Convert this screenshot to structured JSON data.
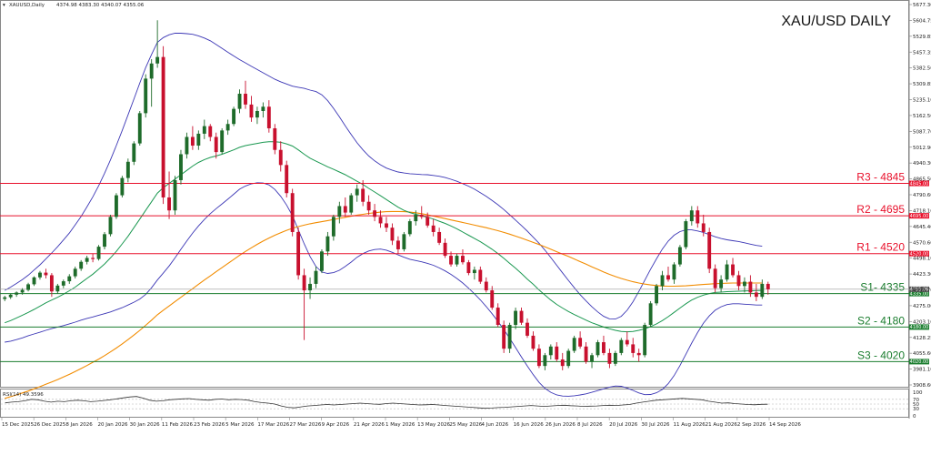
{
  "chart_data": {
    "type": "candlestick",
    "title": "XAU/USD DAILY",
    "header": {
      "symbol_label": "XAUUSD,Daily",
      "ohlc_text": "4374.98 4383.30 4340.07 4355.06"
    },
    "ylim": [
      3908,
      5677
    ],
    "y_ticks": [
      "5677.30",
      "5604.75",
      "5529.85",
      "5457.35",
      "5382.50",
      "5309.85",
      "5235.10",
      "5162.50",
      "5087.70",
      "5012.90",
      "4940.30",
      "4865.50",
      "4790.60",
      "4718.10",
      "4645.40",
      "4570.60",
      "4498.10",
      "4423.30",
      "4350.70",
      "4275.00",
      "4203.10",
      "4128.25",
      "4055.60",
      "3981.10",
      "3908.60"
    ],
    "x_labels": [
      "15 Dec 2025",
      "26 Dec 2025",
      "8 Jan 2026",
      "20 Jan 2026",
      "30 Jan 2026",
      "11 Feb 2026",
      "23 Feb 2026",
      "5 Mar 2026",
      "17 Mar 2026",
      "27 Mar 2026",
      "9 Apr 2026",
      "21 Apr 2026",
      "1 May 2026",
      "13 May 2026",
      "25 May 2026",
      "4 Jun 2026",
      "16 Jun 2026",
      "26 Jun 2026",
      "8 Jul 2026",
      "20 Jul 2026",
      "30 Jul 2026",
      "11 Aug 2026",
      "21 Aug 2026",
      "2 Sep 2026",
      "14 Sep 2026"
    ],
    "current_price": {
      "value": 4355.06,
      "label": "4355.06"
    },
    "levels": [
      {
        "name": "R3 - 4845",
        "value": 4845,
        "tag": "4845.00",
        "color": "#e8102b"
      },
      {
        "name": "R2 - 4695",
        "value": 4695,
        "tag": "4695.00",
        "color": "#e8102b"
      },
      {
        "name": "R1 - 4520",
        "value": 4520,
        "tag": "4520.00",
        "color": "#e8102b"
      },
      {
        "name": "S1- 4335",
        "value": 4335,
        "tag": "4335.00",
        "color": "#1a7d2e"
      },
      {
        "name": "S2 - 4180",
        "value": 4180,
        "tag": "4180.00",
        "color": "#1a7d2e"
      },
      {
        "name": "S3 - 4020",
        "value": 4020,
        "tag": "4020.00",
        "color": "#1a7d2e"
      }
    ],
    "colors": {
      "bull": "#1e6b2a",
      "bear": "#c8102e",
      "bollinger": "#3b36b5",
      "ma_fast": "#1a9850",
      "ma_slow": "#f28c00",
      "rsi": "#333333"
    },
    "rsi": {
      "label": "RSI(14) 49.3596",
      "ylim": [
        0,
        100
      ],
      "levels": [
        30,
        50,
        70
      ],
      "tick_labels": [
        "100",
        "70",
        "50",
        "30",
        "0"
      ],
      "values": [
        55,
        58,
        60,
        64,
        70,
        68,
        62,
        58,
        62,
        60,
        64,
        66,
        64,
        60,
        62,
        65,
        68,
        72,
        76,
        80,
        82,
        75,
        66,
        62,
        64,
        68,
        70,
        72,
        73,
        70,
        68,
        66,
        70,
        71,
        68,
        70,
        69,
        66,
        60,
        56,
        54,
        50,
        42,
        36,
        34,
        38,
        42,
        44,
        46,
        48,
        46,
        48,
        50,
        52,
        54,
        52,
        50,
        49,
        52,
        54,
        52,
        50,
        48,
        46,
        47,
        48,
        46,
        44,
        42,
        40,
        38,
        36,
        34,
        32,
        33,
        35,
        36,
        38,
        40,
        42,
        44,
        42,
        40,
        42,
        44,
        45,
        43,
        42,
        40,
        41,
        42,
        44,
        45,
        44,
        46,
        48,
        54,
        58,
        62,
        66,
        68,
        70,
        72,
        74,
        72,
        70,
        68,
        62,
        58,
        54,
        55,
        52,
        50,
        48,
        47,
        49,
        49.4
      ]
    },
    "candles": [
      [
        4310,
        4325,
        4300,
        4318
      ],
      [
        4318,
        4335,
        4310,
        4330
      ],
      [
        4330,
        4345,
        4320,
        4340
      ],
      [
        4340,
        4360,
        4330,
        4352
      ],
      [
        4352,
        4385,
        4345,
        4378
      ],
      [
        4378,
        4415,
        4370,
        4410
      ],
      [
        4410,
        4440,
        4400,
        4432
      ],
      [
        4432,
        4450,
        4405,
        4420
      ],
      [
        4420,
        4430,
        4320,
        4345
      ],
      [
        4345,
        4380,
        4335,
        4372
      ],
      [
        4372,
        4400,
        4360,
        4392
      ],
      [
        4392,
        4425,
        4380,
        4415
      ],
      [
        4415,
        4460,
        4405,
        4450
      ],
      [
        4450,
        4490,
        4440,
        4482
      ],
      [
        4482,
        4510,
        4470,
        4500
      ],
      [
        4500,
        4520,
        4480,
        4495
      ],
      [
        4495,
        4560,
        4488,
        4552
      ],
      [
        4552,
        4620,
        4540,
        4610
      ],
      [
        4610,
        4700,
        4600,
        4690
      ],
      [
        4690,
        4800,
        4680,
        4790
      ],
      [
        4790,
        4880,
        4780,
        4870
      ],
      [
        4870,
        4960,
        4850,
        4945
      ],
      [
        4945,
        5040,
        4930,
        5030
      ],
      [
        5030,
        5180,
        5020,
        5170
      ],
      [
        5170,
        5350,
        5150,
        5330
      ],
      [
        5330,
        5420,
        5200,
        5400
      ],
      [
        5400,
        5600,
        5380,
        5430
      ],
      [
        5430,
        5480,
        4750,
        4780
      ],
      [
        4780,
        4900,
        4680,
        4720
      ],
      [
        4720,
        4880,
        4700,
        4860
      ],
      [
        4860,
        5000,
        4840,
        4980
      ],
      [
        4980,
        5080,
        4960,
        5060
      ],
      [
        5060,
        5110,
        5000,
        5020
      ],
      [
        5020,
        5090,
        5000,
        5075
      ],
      [
        5075,
        5140,
        5050,
        5110
      ],
      [
        5110,
        5120,
        5040,
        5060
      ],
      [
        5060,
        5080,
        4960,
        4990
      ],
      [
        4990,
        5100,
        4980,
        5090
      ],
      [
        5090,
        5140,
        5070,
        5120
      ],
      [
        5120,
        5200,
        5110,
        5190
      ],
      [
        5190,
        5280,
        5170,
        5260
      ],
      [
        5260,
        5320,
        5190,
        5210
      ],
      [
        5210,
        5250,
        5130,
        5150
      ],
      [
        5150,
        5200,
        5120,
        5180
      ],
      [
        5180,
        5220,
        5150,
        5200
      ],
      [
        5200,
        5230,
        5080,
        5100
      ],
      [
        5100,
        5120,
        4980,
        5000
      ],
      [
        5000,
        5040,
        4900,
        4930
      ],
      [
        4930,
        4950,
        4780,
        4800
      ],
      [
        4800,
        4820,
        4600,
        4620
      ],
      [
        4620,
        4640,
        4400,
        4420
      ],
      [
        4420,
        4450,
        4120,
        4350
      ],
      [
        4350,
        4410,
        4310,
        4380
      ],
      [
        4380,
        4460,
        4360,
        4440
      ],
      [
        4440,
        4540,
        4430,
        4530
      ],
      [
        4530,
        4620,
        4510,
        4600
      ],
      [
        4600,
        4700,
        4580,
        4690
      ],
      [
        4690,
        4760,
        4660,
        4740
      ],
      [
        4740,
        4780,
        4690,
        4710
      ],
      [
        4710,
        4800,
        4700,
        4790
      ],
      [
        4790,
        4840,
        4760,
        4820
      ],
      [
        4820,
        4860,
        4740,
        4760
      ],
      [
        4760,
        4790,
        4700,
        4720
      ],
      [
        4720,
        4750,
        4670,
        4690
      ],
      [
        4690,
        4720,
        4640,
        4660
      ],
      [
        4660,
        4690,
        4620,
        4640
      ],
      [
        4640,
        4660,
        4560,
        4580
      ],
      [
        4580,
        4600,
        4520,
        4540
      ],
      [
        4540,
        4620,
        4530,
        4610
      ],
      [
        4610,
        4680,
        4600,
        4670
      ],
      [
        4670,
        4720,
        4650,
        4700
      ],
      [
        4700,
        4740,
        4680,
        4690
      ],
      [
        4690,
        4710,
        4640,
        4650
      ],
      [
        4650,
        4680,
        4600,
        4620
      ],
      [
        4620,
        4640,
        4560,
        4570
      ],
      [
        4570,
        4590,
        4500,
        4510
      ],
      [
        4510,
        4530,
        4460,
        4470
      ],
      [
        4470,
        4520,
        4460,
        4510
      ],
      [
        4510,
        4540,
        4470,
        4480
      ],
      [
        4480,
        4490,
        4420,
        4430
      ],
      [
        4430,
        4460,
        4400,
        4445
      ],
      [
        4445,
        4460,
        4380,
        4390
      ],
      [
        4390,
        4410,
        4340,
        4350
      ],
      [
        4350,
        4370,
        4260,
        4270
      ],
      [
        4270,
        4290,
        4180,
        4190
      ],
      [
        4190,
        4210,
        4060,
        4080
      ],
      [
        4080,
        4200,
        4060,
        4190
      ],
      [
        4190,
        4270,
        4170,
        4255
      ],
      [
        4255,
        4270,
        4190,
        4200
      ],
      [
        4200,
        4220,
        4130,
        4140
      ],
      [
        4140,
        4160,
        4070,
        4080
      ],
      [
        4080,
        4100,
        3990,
        4000
      ],
      [
        4000,
        4060,
        3980,
        4050
      ],
      [
        4050,
        4100,
        4030,
        4090
      ],
      [
        4090,
        4110,
        4020,
        4030
      ],
      [
        4030,
        4060,
        3980,
        4000
      ],
      [
        4000,
        4080,
        3990,
        4070
      ],
      [
        4070,
        4140,
        4060,
        4130
      ],
      [
        4130,
        4160,
        4080,
        4090
      ],
      [
        4090,
        4110,
        4010,
        4020
      ],
      [
        4020,
        4060,
        3990,
        4050
      ],
      [
        4050,
        4120,
        4040,
        4110
      ],
      [
        4110,
        4140,
        4050,
        4060
      ],
      [
        4060,
        4080,
        3990,
        4010
      ],
      [
        4010,
        4070,
        4000,
        4060
      ],
      [
        4060,
        4130,
        4050,
        4120
      ],
      [
        4120,
        4160,
        4090,
        4100
      ],
      [
        4100,
        4130,
        4040,
        4060
      ],
      [
        4060,
        4080,
        4020,
        4050
      ],
      [
        4050,
        4200,
        4040,
        4190
      ],
      [
        4190,
        4300,
        4180,
        4290
      ],
      [
        4290,
        4380,
        4280,
        4370
      ],
      [
        4370,
        4440,
        4350,
        4420
      ],
      [
        4420,
        4460,
        4390,
        4400
      ],
      [
        4400,
        4480,
        4380,
        4470
      ],
      [
        4470,
        4560,
        4460,
        4550
      ],
      [
        4550,
        4680,
        4540,
        4670
      ],
      [
        4670,
        4740,
        4650,
        4720
      ],
      [
        4720,
        4740,
        4640,
        4660
      ],
      [
        4660,
        4700,
        4600,
        4620
      ],
      [
        4620,
        4640,
        4430,
        4450
      ],
      [
        4450,
        4470,
        4340,
        4360
      ],
      [
        4360,
        4420,
        4340,
        4400
      ],
      [
        4400,
        4490,
        4390,
        4470
      ],
      [
        4470,
        4500,
        4410,
        4420
      ],
      [
        4420,
        4440,
        4350,
        4370
      ],
      [
        4370,
        4410,
        4340,
        4390
      ],
      [
        4390,
        4420,
        4320,
        4340
      ],
      [
        4340,
        4380,
        4300,
        4320
      ],
      [
        4320,
        4400,
        4310,
        4380
      ],
      [
        4380,
        4390,
        4330,
        4355
      ]
    ],
    "ma_fast": [
      4200,
      4210,
      4222,
      4235,
      4248,
      4262,
      4277,
      4292,
      4305,
      4318,
      4332,
      4348,
      4365,
      4385,
      4405,
      4425,
      4448,
      4472,
      4500,
      4530,
      4565,
      4600,
      4640,
      4680,
      4720,
      4760,
      4800,
      4825,
      4845,
      4865,
      4885,
      4905,
      4925,
      4942,
      4955,
      4965,
      4972,
      4980,
      4990,
      5000,
      5012,
      5020,
      5025,
      5030,
      5035,
      5038,
      5038,
      5035,
      5028,
      5018,
      5000,
      4980,
      4962,
      4948,
      4935,
      4922,
      4910,
      4898,
      4885,
      4870,
      4855,
      4840,
      4822,
      4805,
      4788,
      4770,
      4752,
      4735,
      4720,
      4710,
      4702,
      4695,
      4688,
      4680,
      4670,
      4660,
      4648,
      4635,
      4620,
      4605,
      4590,
      4575,
      4558,
      4540,
      4520,
      4498,
      4475,
      4452,
      4428,
      4402,
      4378,
      4352,
      4328,
      4305,
      4285,
      4268,
      4252,
      4238,
      4225,
      4212,
      4200,
      4190,
      4180,
      4172,
      4165,
      4160,
      4158,
      4160,
      4165,
      4172,
      4182,
      4195,
      4210,
      4228,
      4248,
      4268,
      4288,
      4305,
      4318,
      4328,
      4335,
      4340,
      4342,
      4344,
      4345,
      4346,
      4347,
      4348,
      4349,
      4350
    ],
    "ma_slow": [
      3850,
      3858,
      3866,
      3875,
      3884,
      3894,
      3904,
      3915,
      3926,
      3937,
      3949,
      3961,
      3974,
      3988,
      4002,
      4017,
      4032,
      4048,
      4065,
      4083,
      4102,
      4122,
      4143,
      4165,
      4188,
      4212,
      4237,
      4258,
      4278,
      4298,
      4318,
      4338,
      4358,
      4378,
      4398,
      4417,
      4436,
      4455,
      4474,
      4493,
      4512,
      4530,
      4547,
      4563,
      4578,
      4592,
      4605,
      4617,
      4628,
      4637,
      4645,
      4652,
      4658,
      4663,
      4668,
      4673,
      4678,
      4683,
      4688,
      4693,
      4698,
      4702,
      4706,
      4709,
      4712,
      4714,
      4715,
      4715,
      4714,
      4712,
      4709,
      4705,
      4700,
      4694,
      4688,
      4682,
      4676,
      4670,
      4664,
      4658,
      4652,
      4646,
      4640,
      4633,
      4626,
      4618,
      4610,
      4601,
      4592,
      4582,
      4572,
      4562,
      4551,
      4540,
      4529,
      4518,
      4507,
      4495,
      4483,
      4471,
      4459,
      4447,
      4435,
      4424,
      4414,
      4405,
      4397,
      4390,
      4384,
      4379,
      4375,
      4372,
      4370,
      4369,
      4369,
      4370,
      4371,
      4373,
      4375,
      4377,
      4379,
      4381,
      4382,
      4383,
      4384,
      4384,
      4384,
      4384,
      4384,
      4384
    ],
    "bb_mid": [
      4230,
      4240,
      4252,
      4265,
      4280,
      4296,
      4312,
      4330,
      4348,
      4366,
      4385,
      4405,
      4428,
      4452,
      4478,
      4505,
      4535,
      4567,
      4602,
      4640,
      4680,
      4722,
      4765,
      4810,
      4856,
      4902,
      4948,
      4975,
      4998,
      5020,
      5040,
      5058,
      5075,
      5088,
      5098,
      5105,
      5108,
      5110,
      5112,
      5115,
      5118,
      5118,
      5115,
      5110,
      5102,
      5090,
      5072,
      5050,
      5025,
      4995,
      4960,
      4925,
      4892,
      4865,
      4845,
      4828,
      4812,
      4798,
      4786,
      4776,
      4768,
      4760,
      4752,
      4744,
      4736,
      4726,
      4716,
      4706,
      4698,
      4692,
      4688,
      4684,
      4680,
      4674,
      4666,
      4656,
      4644,
      4630,
      4614,
      4596,
      4576,
      4554,
      4530,
      4504,
      4476,
      4446,
      4414,
      4380,
      4346,
      4312,
      4278,
      4246,
      4216,
      4190,
      4166,
      4146,
      4128,
      4112,
      4098,
      4086,
      4076,
      4068,
      4062,
      4060,
      4062,
      4068,
      4078,
      4092,
      4110,
      4132,
      4158,
      4186,
      4216,
      4248,
      4280,
      4312,
      4342,
      4368,
      4390,
      4408,
      4420,
      4428,
      4432,
      4434,
      4434,
      4432,
      4428,
      4424,
      4420,
      4418
    ],
    "bb_band": [
      120,
      125,
      130,
      135,
      140,
      148,
      156,
      165,
      175,
      186,
      198,
      210,
      225,
      240,
      258,
      278,
      300,
      325,
      352,
      380,
      410,
      440,
      470,
      500,
      525,
      540,
      550,
      545,
      535,
      520,
      500,
      480,
      460,
      440,
      420,
      400,
      380,
      360,
      340,
      320,
      300,
      285,
      272,
      262,
      255,
      252,
      255,
      265,
      280,
      300,
      330,
      360,
      385,
      405,
      410,
      400,
      380,
      355,
      325,
      295,
      265,
      240,
      220,
      205,
      195,
      190,
      190,
      192,
      195,
      198,
      200,
      202,
      205,
      208,
      212,
      216,
      220,
      225,
      230,
      236,
      242,
      248,
      255,
      262,
      270,
      278,
      286,
      295,
      304,
      312,
      318,
      322,
      320,
      312,
      300,
      285,
      268,
      250,
      232,
      215,
      198,
      182,
      168,
      158,
      155,
      162,
      180,
      205,
      235,
      265,
      290,
      310,
      325,
      330,
      325,
      310,
      288,
      262,
      235,
      210,
      188,
      170,
      158,
      150,
      146,
      144,
      142,
      140,
      138,
      136
    ]
  }
}
